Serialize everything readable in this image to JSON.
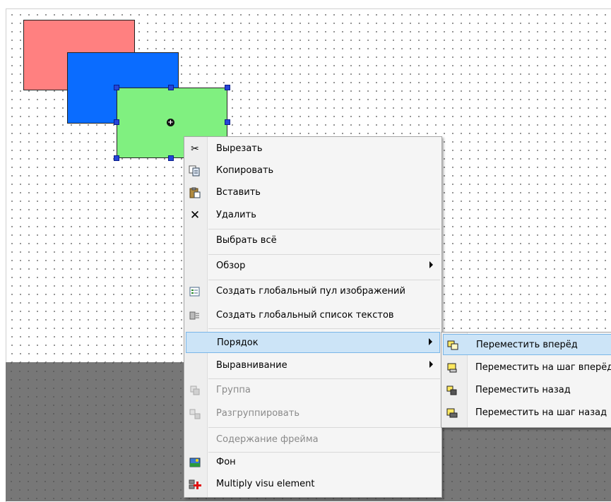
{
  "shapes": {
    "red_color": "#ff8080",
    "blue_color": "#0a6cff",
    "green_color": "#80f080",
    "center_marker": "+"
  },
  "context_menu": {
    "items": [
      {
        "icon": "scissors-icon",
        "label": "Вырезать",
        "enabled": true
      },
      {
        "icon": "copy-icon",
        "label": "Копировать",
        "enabled": true
      },
      {
        "icon": "paste-icon",
        "label": "Вставить",
        "enabled": true
      },
      {
        "icon": "delete-icon",
        "label": "Удалить",
        "enabled": true
      },
      {
        "label": "Выбрать всё",
        "enabled": true
      },
      {
        "label": "Обзор",
        "enabled": true,
        "submenu": true
      },
      {
        "icon": "image-pool-icon",
        "label": "Создать глобальный пул изображений",
        "enabled": true
      },
      {
        "icon": "text-list-icon",
        "label": "Создать глобальный список текстов",
        "enabled": true
      },
      {
        "label": "Порядок",
        "enabled": true,
        "submenu": true,
        "highlighted": true
      },
      {
        "label": "Выравнивание",
        "enabled": true,
        "submenu": true
      },
      {
        "icon": "group-icon",
        "label": "Группа",
        "enabled": false
      },
      {
        "icon": "ungroup-icon",
        "label": "Разгруппировать",
        "enabled": false
      },
      {
        "label": "Содержание фрейма",
        "enabled": false
      },
      {
        "icon": "background-icon",
        "label": "Фон",
        "enabled": true
      },
      {
        "icon": "multiply-element-icon",
        "label": "Multiply visu element",
        "enabled": true
      }
    ]
  },
  "order_submenu": {
    "items": [
      {
        "icon": "bring-to-front-icon",
        "label": "Переместить вперёд",
        "highlighted": true
      },
      {
        "icon": "bring-forward-icon",
        "label": "Переместить на шаг вперёд"
      },
      {
        "icon": "send-to-back-icon",
        "label": "Переместить назад"
      },
      {
        "icon": "send-backward-icon",
        "label": "Переместить на шаг назад"
      }
    ]
  }
}
